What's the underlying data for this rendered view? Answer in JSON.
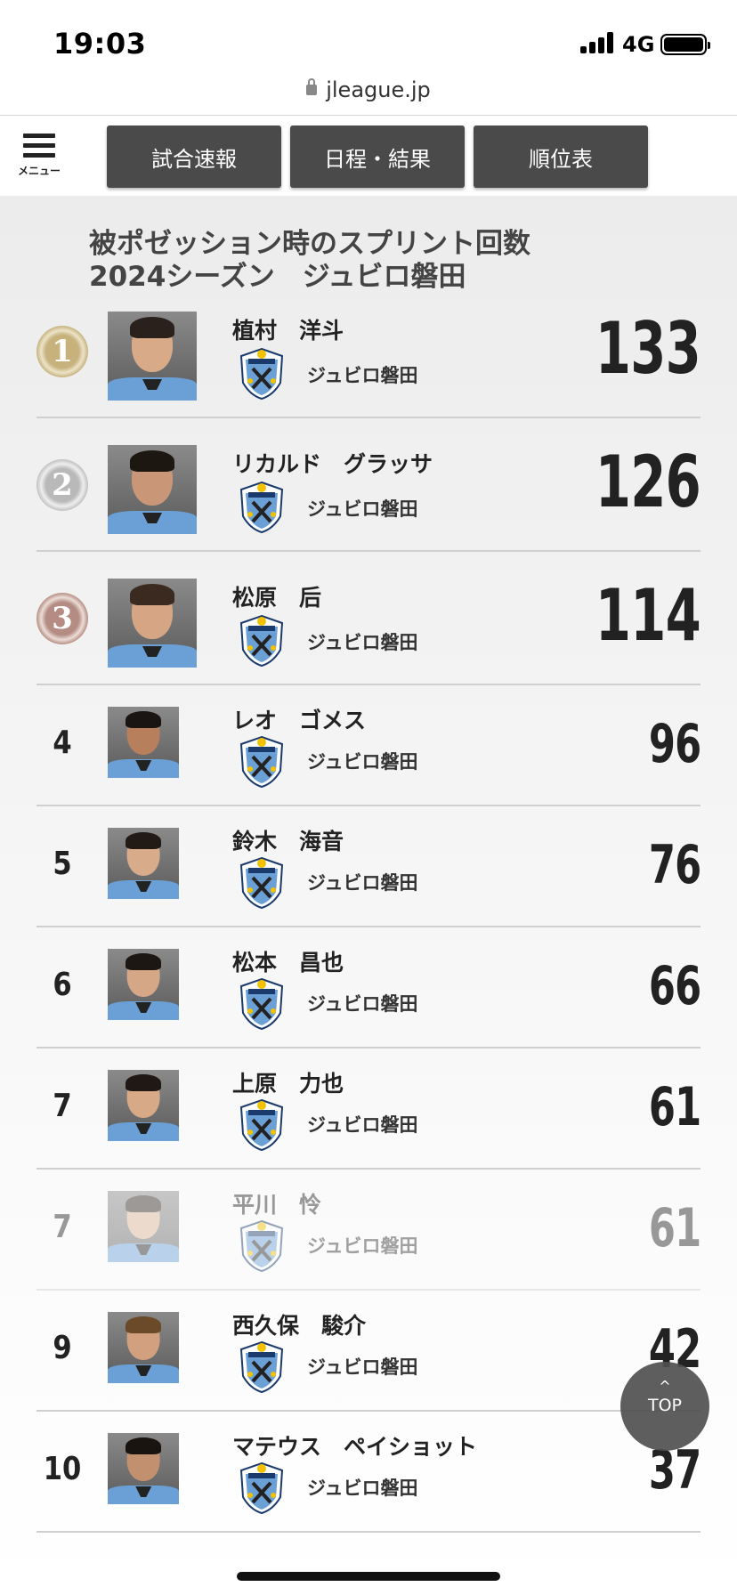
{
  "status": {
    "time": "19:03",
    "network": "4G"
  },
  "browser": {
    "url": "jleague.jp"
  },
  "nav": {
    "menu_label": "メニュー",
    "buttons": [
      "試合速報",
      "日程・結果",
      "順位表"
    ]
  },
  "heading": {
    "line1": "被ポゼッション時のスプリント回数",
    "line2": "2024シーズン　ジュビロ磐田"
  },
  "rankings": [
    {
      "rank": "1",
      "name": "植村　洋斗",
      "team": "ジュビロ磐田",
      "value": "133"
    },
    {
      "rank": "2",
      "name": "リカルド　グラッサ",
      "team": "ジュビロ磐田",
      "value": "126"
    },
    {
      "rank": "3",
      "name": "松原　后",
      "team": "ジュビロ磐田",
      "value": "114"
    },
    {
      "rank": "4",
      "name": "レオ　ゴメス",
      "team": "ジュビロ磐田",
      "value": "96"
    },
    {
      "rank": "5",
      "name": "鈴木　海音",
      "team": "ジュビロ磐田",
      "value": "76"
    },
    {
      "rank": "6",
      "name": "松本　昌也",
      "team": "ジュビロ磐田",
      "value": "66"
    },
    {
      "rank": "7",
      "name": "上原　力也",
      "team": "ジュビロ磐田",
      "value": "61"
    },
    {
      "rank": "7",
      "name": "平川　怜",
      "team": "ジュビロ磐田",
      "value": "61"
    },
    {
      "rank": "9",
      "name": "西久保　駿介",
      "team": "ジュビロ磐田",
      "value": "42"
    },
    {
      "rank": "10",
      "name": "マテウス　ペイショット",
      "team": "ジュビロ磐田",
      "value": "37"
    }
  ],
  "top_button": {
    "arrow": "^",
    "label": "TOP"
  },
  "colors": {
    "nav_button": "#4a4a4a",
    "gold": "#c7b17d",
    "silver": "#b9b9b9",
    "bronze": "#b48c83",
    "team_blue": "#6aa0d6"
  }
}
